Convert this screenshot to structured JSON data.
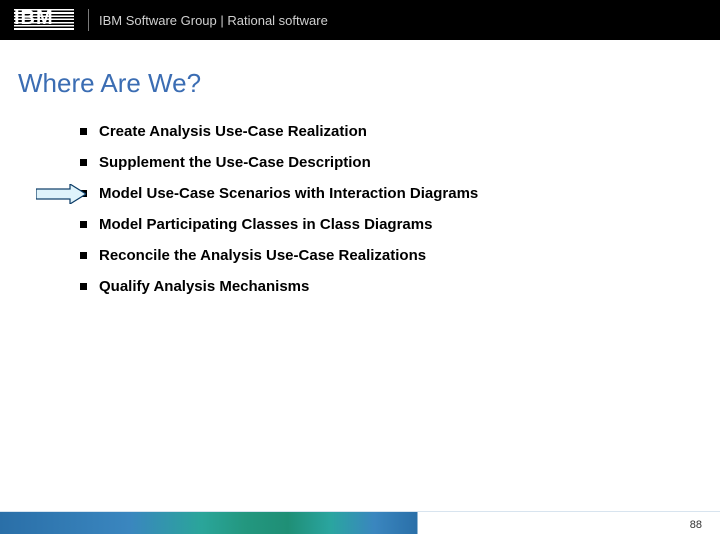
{
  "header": {
    "logo_text": "IBM",
    "text": "IBM Software Group | Rational software"
  },
  "title": "Where Are We?",
  "bullets": [
    {
      "label": "Create Analysis Use-Case Realization",
      "current": false
    },
    {
      "label": "Supplement the Use-Case Description",
      "current": false
    },
    {
      "label": "Model Use-Case Scenarios with Interaction Diagrams",
      "current": true
    },
    {
      "label": "Model Participating Classes in Class Diagrams",
      "current": false
    },
    {
      "label": "Reconcile the Analysis Use-Case Realizations",
      "current": false
    },
    {
      "label": "Qualify Analysis Mechanisms",
      "current": false
    }
  ],
  "page_number": "88"
}
